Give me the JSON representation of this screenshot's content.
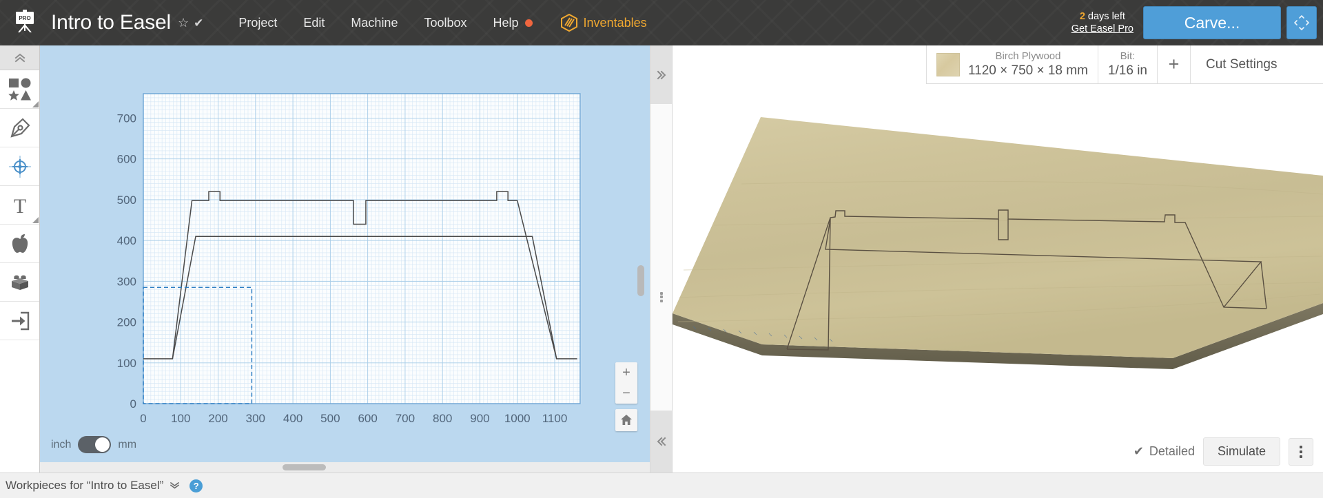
{
  "header": {
    "logo_icon": "easel-pro-logo",
    "project_title": "Intro to Easel",
    "star_icon": "☆",
    "check_icon": "✔",
    "menus": [
      {
        "label": "Project",
        "name": "menu-project"
      },
      {
        "label": "Edit",
        "name": "menu-edit"
      },
      {
        "label": "Machine",
        "name": "menu-machine"
      },
      {
        "label": "Toolbox",
        "name": "menu-toolbox"
      },
      {
        "label": "Help",
        "name": "menu-help",
        "badge": true
      }
    ],
    "inventables_label": "Inventables",
    "trial_count": "2",
    "trial_text": " days left",
    "get_pro_label": "Get Easel Pro",
    "carve_label": "Carve...",
    "dpad_icon": "move-pad-icon",
    "accent_blue": "#4f9ed8",
    "accent_orange": "#f0a830",
    "badge_red": "#f0663f",
    "bar_bg": "#3b3b3a"
  },
  "material_bar": {
    "material_name": "Birch Plywood",
    "material_size": "1120 × 750 × 18 mm",
    "bit_caption": "Bit:",
    "bit_value": "1/16 in",
    "add_label": "+",
    "cut_settings_label": "Cut Settings",
    "swatch_color": "#ddd2a8"
  },
  "left_rail": {
    "collapse_icon": "chevron-double-up-icon",
    "tools": [
      {
        "name": "shapes-tool",
        "icon": "shapes-icon",
        "has_submenu": true
      },
      {
        "name": "pen-tool",
        "icon": "pen-icon",
        "has_submenu": false
      },
      {
        "name": "center-point-tool",
        "icon": "target-icon",
        "has_submenu": false
      },
      {
        "name": "text-tool",
        "icon": "text-t-icon",
        "has_submenu": true
      },
      {
        "name": "apps-tool",
        "icon": "apple-icon",
        "has_submenu": false
      },
      {
        "name": "parts-tool",
        "icon": "lego-brick-icon",
        "has_submenu": false
      },
      {
        "name": "import-tool",
        "icon": "import-arrow-icon",
        "has_submenu": false
      }
    ]
  },
  "design_canvas": {
    "unit_left_label": "inch",
    "unit_right_label": "mm",
    "unit_selected": "mm",
    "zoom_in_label": "+",
    "zoom_out_label": "−",
    "home_icon": "home-icon",
    "background_color": "#bbd8ef"
  },
  "chart_data": {
    "type": "line",
    "title": "",
    "xlabel": "",
    "ylabel": "",
    "xlim": [
      0,
      1170
    ],
    "ylim": [
      0,
      760
    ],
    "grid": true,
    "major_step": 100,
    "minor_step": 10,
    "xticks": [
      0,
      100,
      200,
      300,
      400,
      500,
      600,
      700,
      800,
      900,
      1000,
      1100
    ],
    "yticks": [
      0,
      100,
      200,
      300,
      400,
      500,
      600,
      700
    ],
    "legend": "none",
    "series": [
      {
        "name": "outer-profile",
        "kind": "polyline",
        "stroke": "#4a4a4a",
        "points": [
          [
            0,
            110
          ],
          [
            78,
            110
          ],
          [
            130,
            498
          ],
          [
            175,
            498
          ],
          [
            175,
            520
          ],
          [
            205,
            520
          ],
          [
            205,
            498
          ],
          [
            562,
            498
          ],
          [
            562,
            440
          ],
          [
            595,
            440
          ],
          [
            595,
            498
          ],
          [
            945,
            498
          ],
          [
            945,
            520
          ],
          [
            975,
            520
          ],
          [
            975,
            498
          ],
          [
            1000,
            498
          ],
          [
            1105,
            110
          ],
          [
            1160,
            110
          ]
        ]
      },
      {
        "name": "inner-profile",
        "kind": "polyline",
        "stroke": "#4a4a4a",
        "points": [
          [
            78,
            110
          ],
          [
            140,
            410
          ],
          [
            1040,
            410
          ],
          [
            1105,
            110
          ]
        ]
      },
      {
        "name": "selection-box",
        "kind": "dashed-rect",
        "stroke": "#2f7fc4",
        "x0": 0,
        "y0": 0,
        "x1": 290,
        "y1": 285
      }
    ],
    "workpiece_bounds": {
      "x0": 0,
      "y0": 0,
      "x1": 1168,
      "y1": 760
    }
  },
  "divider": {
    "expand_icon": "chevron-double-right-icon",
    "collapse_icon": "chevron-double-left-icon",
    "grip_icon": "drag-dots-icon"
  },
  "preview_3d": {
    "detailed_label": "Detailed",
    "detailed_checked": true,
    "check_icon": "✔",
    "simulate_label": "Simulate",
    "kebab_icon": "more-vertical-icon",
    "wood_top": "#cfc49c",
    "wood_edge": "#6c6854"
  },
  "bottom_bar": {
    "workpieces_label": "Workpieces for “Intro to Easel”",
    "caret_icon": "chevron-down-icon",
    "help_icon": "?"
  }
}
